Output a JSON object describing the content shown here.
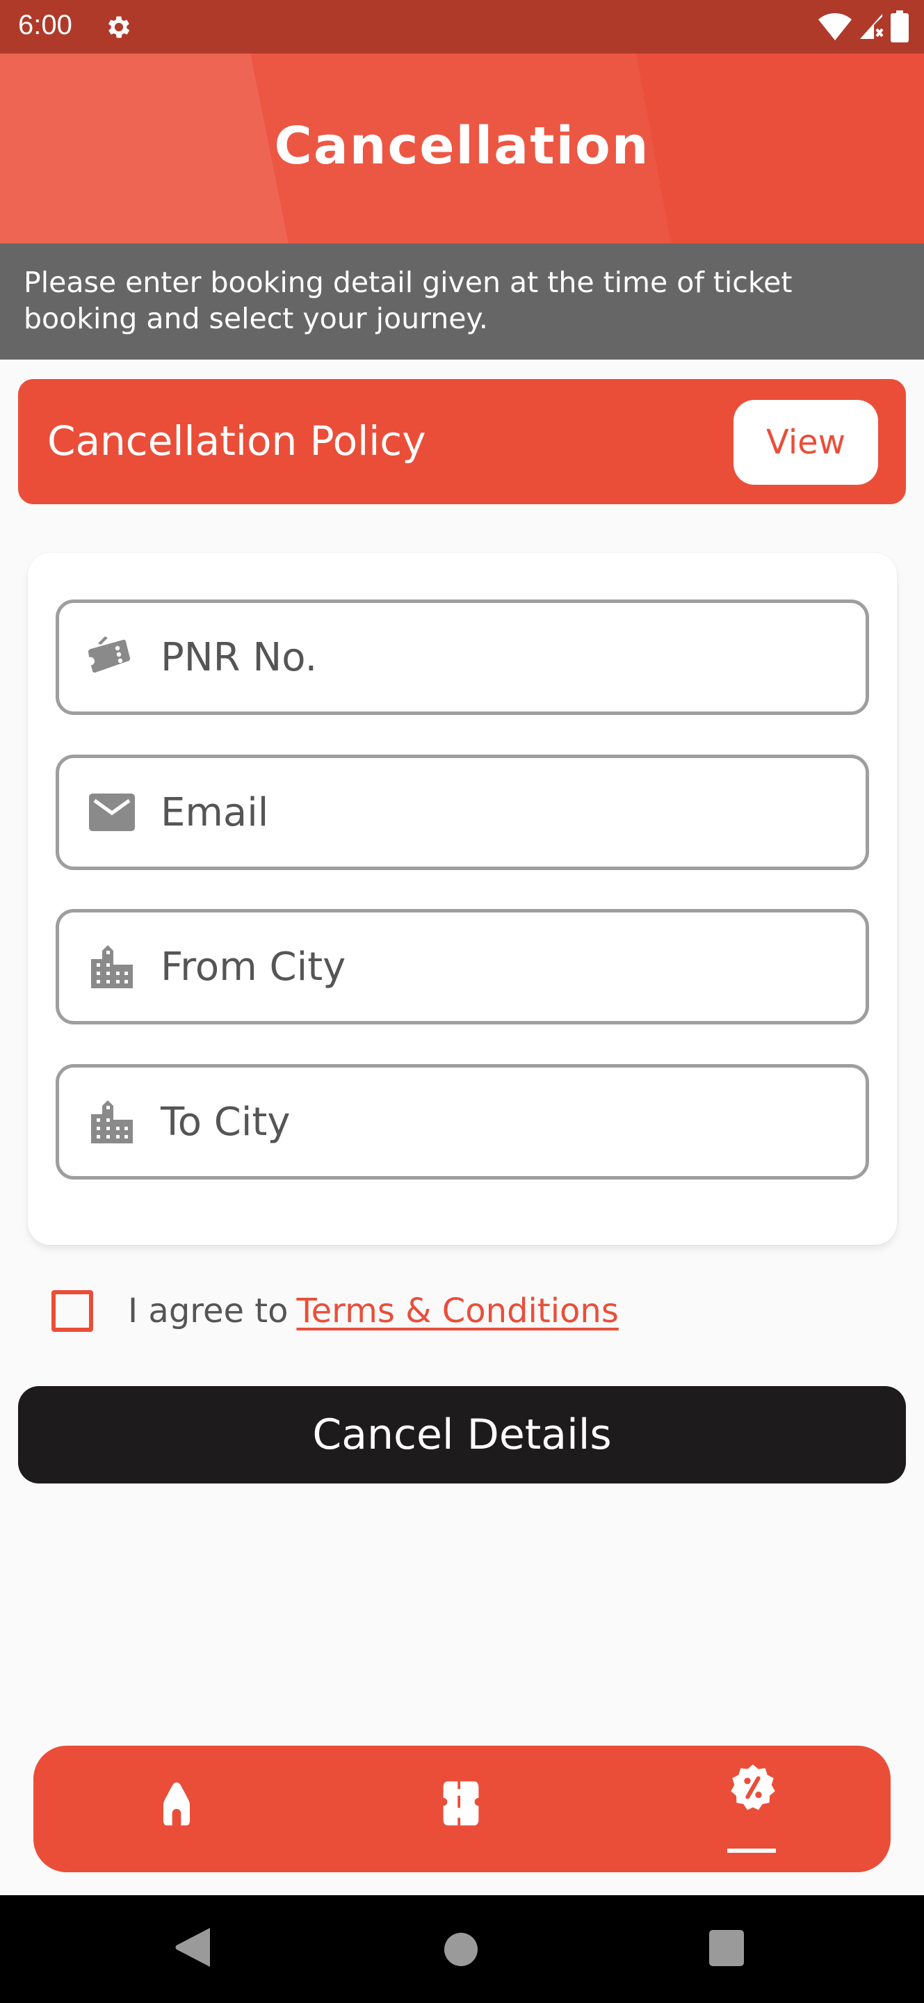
{
  "status_bar": {
    "time": "6:00",
    "icons": [
      "settings-gear-icon",
      "wifi-icon",
      "signal-icon",
      "battery-icon"
    ]
  },
  "header": {
    "title": "Cancellation"
  },
  "info_banner": {
    "text": "Please enter booking detail given at the time of ticket booking and select your journey."
  },
  "policy": {
    "title": "Cancellation Policy",
    "view_label": "View"
  },
  "form": {
    "fields": [
      {
        "icon": "ticket-icon",
        "placeholder": "PNR No.",
        "value": ""
      },
      {
        "icon": "email-icon",
        "placeholder": "Email",
        "value": ""
      },
      {
        "icon": "city-icon",
        "placeholder": "From City",
        "value": ""
      },
      {
        "icon": "city-icon",
        "placeholder": "To City",
        "value": ""
      }
    ]
  },
  "agreement": {
    "checked": false,
    "text": "I agree to",
    "link_label": "Terms & Conditions"
  },
  "submit": {
    "label": "Cancel Details"
  },
  "bottom_nav": {
    "items": [
      {
        "icon": "home-icon",
        "active": false
      },
      {
        "icon": "ticket-icon",
        "active": false
      },
      {
        "icon": "discount-badge-icon",
        "active": true
      }
    ]
  },
  "system_nav": {
    "buttons": [
      "back",
      "home",
      "recents"
    ]
  },
  "colors": {
    "primary": "#EA4E39",
    "status_bar": "#AF3A2A",
    "info_banner": "#666666",
    "button_dark": "#1D1B1C",
    "field_border": "#9E9E9E",
    "icon_gray": "#8A8A8A"
  }
}
